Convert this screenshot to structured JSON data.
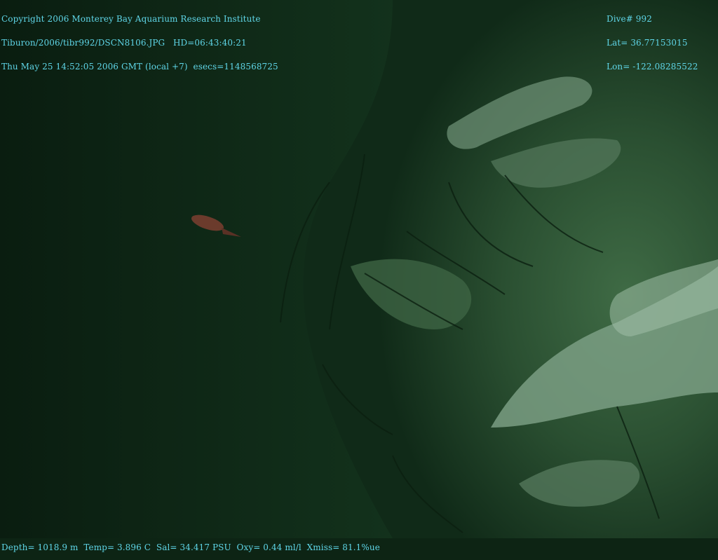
{
  "overlay": {
    "header_left": [
      "Copyright 2006 Monterey Bay Aquarium Research Institute",
      "Tiburon/2006/tibr992/DSCN8106.JPG   HD=06:43:40:21",
      "Thu May 25 14:52:05 2006 GMT (local +7)  esecs=1148568725"
    ],
    "header_right": [
      "Dive# 992",
      "Lat= 36.77153015",
      "Lon= -122.08285522"
    ],
    "footer": "Depth= 1018.9 m  Temp= 3.896 C  Sal= 34.417 PSU  Oxy= 0.44 ml/l  Xmiss= 81.1%ue"
  },
  "colors": {
    "overlay_text": "#5fd6e8",
    "water": "#0d2414",
    "rock": "#3f6b45",
    "rock_highlight": "#8fb49a",
    "fish": "#6b3b2c"
  }
}
